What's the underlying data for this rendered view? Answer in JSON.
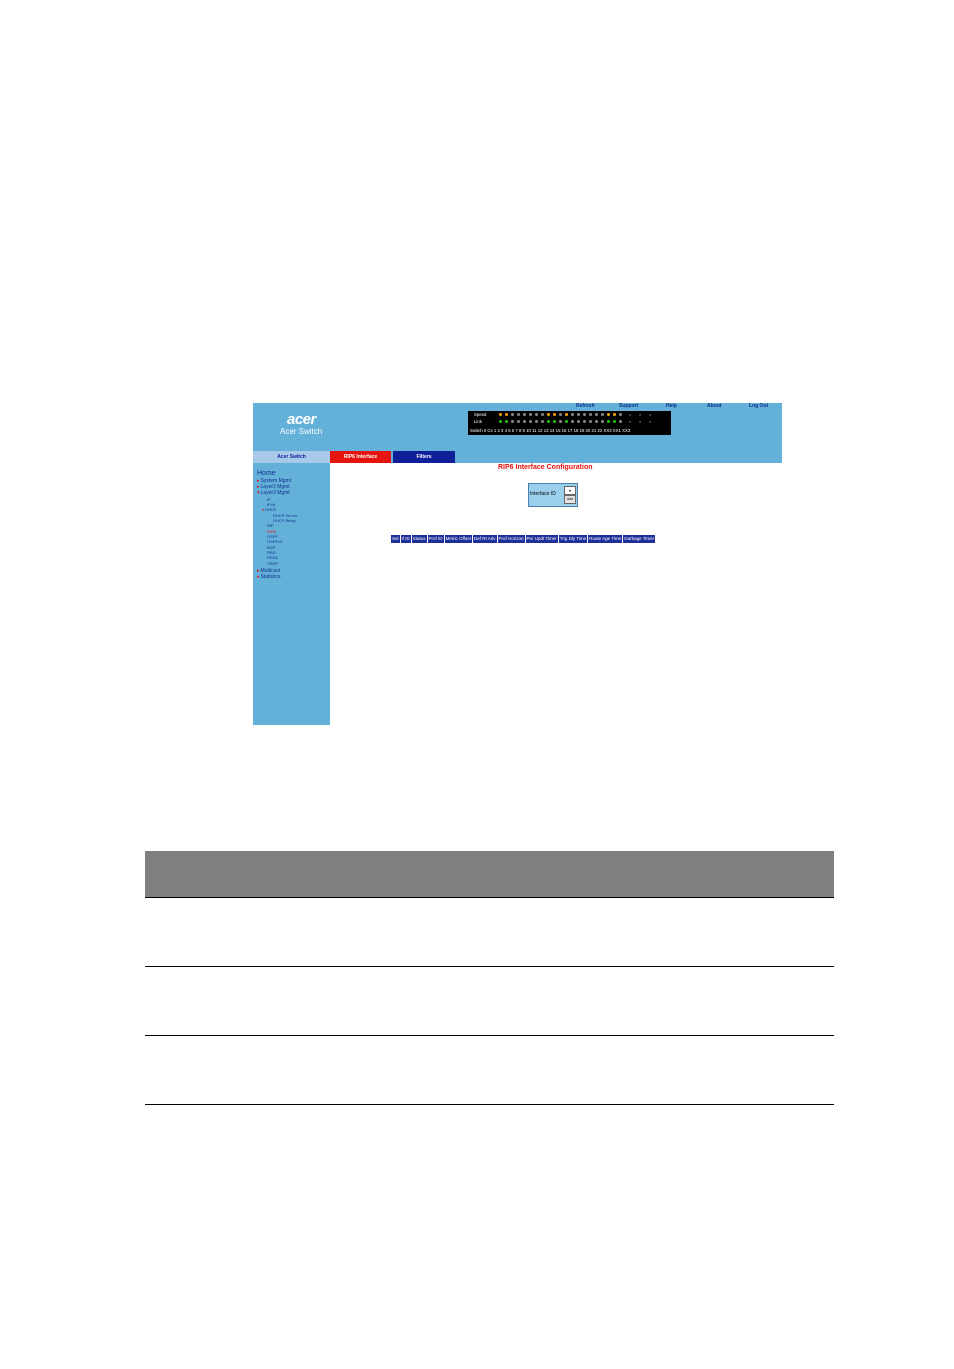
{
  "top_links": [
    "Refresh",
    "Support",
    "Help",
    "About",
    "Log Out"
  ],
  "brand": {
    "logo": "acer",
    "name": "Acer Switch"
  },
  "ports": {
    "speed_label": "Speed",
    "link_label": "Link",
    "numbers_text": "Switch 0 Cs 1 2 3 4 5 6 7 8 9 10 11 12 13 14 15 16 17 18 19 20 21 22 XX3 XX1 XX3",
    "speed_colors": [
      "#f2a400",
      "#f2a400",
      "#888888",
      "#888888",
      "#888888",
      "#888888",
      "#888888",
      "#888888",
      "#f2a400",
      "#f2a400",
      "#888888",
      "#f2a400",
      "#888888",
      "#888888",
      "#888888",
      "#888888",
      "#888888",
      "#888888",
      "#f2a400",
      "#f2a400",
      "#888888"
    ],
    "link_colors": [
      "#22c40f",
      "#22c40f",
      "#888888",
      "#888888",
      "#888888",
      "#888888",
      "#888888",
      "#888888",
      "#22c40f",
      "#22c40f",
      "#888888",
      "#22c40f",
      "#888888",
      "#888888",
      "#888888",
      "#888888",
      "#888888",
      "#888888",
      "#22c40f",
      "#22c40f",
      "#888888"
    ]
  },
  "tabs": {
    "home": "Acer Switch",
    "rip6": "RIP6 Interface",
    "filters": "Filters"
  },
  "sidebar": {
    "home": "Home",
    "items": [
      "System Mgmt",
      "Layer2 Mgmt",
      "Layer3 Mgmt"
    ],
    "layer3": [
      "IP",
      "IPv6",
      "DHCP"
    ],
    "dhcp": [
      "DHCP Server",
      "DHCP Relay"
    ],
    "layer3_rest": [
      "RIP",
      "RIP6",
      "OSPF",
      "OSPFv3",
      "BGP",
      "RRD",
      "RRD6",
      "VRRP"
    ],
    "bottom": [
      "Multicast",
      "Statistics"
    ]
  },
  "main": {
    "title": "RIP6 Interface Configuration",
    "interface_label": "Interface ID",
    "add_button": "Add",
    "columns": [
      "Sel",
      "If ID",
      "Status",
      "Prof ID",
      "Metric Offset",
      "Def Rt Adv",
      "Prof Horizon",
      "Per Updt Timer",
      "Trig Dly Time",
      "Route Age Time",
      "Garbage Timer"
    ]
  },
  "colors": {
    "frame": "#63b0d9",
    "tab_active": "#e5140e",
    "tab_dark": "#0f1f9a",
    "accent_red": "#e3140f"
  }
}
